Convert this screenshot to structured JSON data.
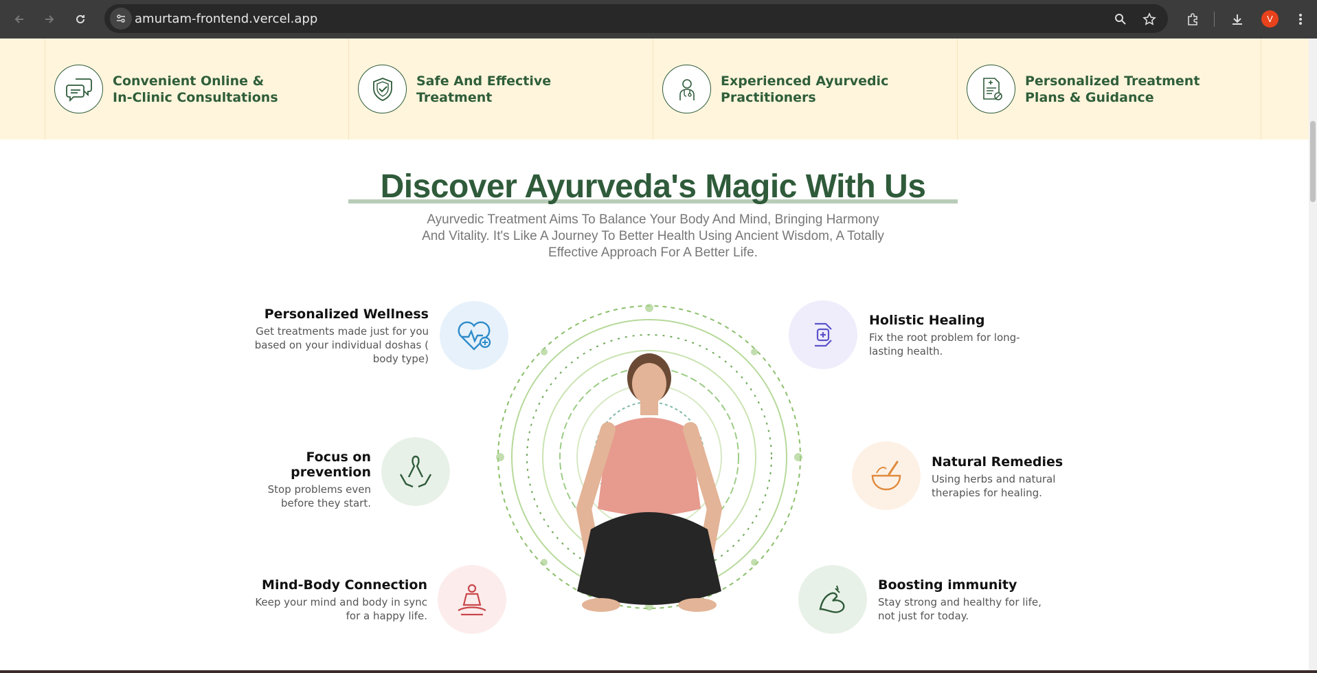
{
  "browser": {
    "url": "amurtam-frontend.vercel.app",
    "profile_initial": "V",
    "profile_color": "#e8421c"
  },
  "features": [
    {
      "line1": "Convenient Online &",
      "line2": "In-Clinic Consultations",
      "icon": "chat-bubbles-icon"
    },
    {
      "line1": "Safe And Effective",
      "line2": "Treatment",
      "icon": "shield-check-icon"
    },
    {
      "line1": "Experienced Ayurvedic",
      "line2": "Practitioners",
      "icon": "doctor-icon"
    },
    {
      "line1": "Personalized Treatment",
      "line2": "Plans & Guidance",
      "icon": "prescription-icon"
    }
  ],
  "section": {
    "title": "Discover Ayurveda's Magic With Us",
    "subtitle": "Ayurvedic Treatment Aims To Balance Your Body And Mind, Bringing Harmony And Vitality. It's Like A Journey To Better Health Using Ancient Wisdom, A Totally Effective Approach For A Better Life."
  },
  "benefits_left": [
    {
      "title": "Personalized Wellness",
      "desc": "Get treatments made just for you based on your individual doshas ( body type)",
      "icon": "heart-pulse-icon",
      "color": "#e6f1fb"
    },
    {
      "title": "Focus on prevention",
      "desc": "Stop problems even before they start.",
      "icon": "ribbon-hands-icon",
      "color": "#e8f1e8"
    },
    {
      "title": "Mind-Body Connection",
      "desc": "Keep your mind and body in sync for a happy life.",
      "icon": "meditation-icon",
      "color": "#fcecec"
    }
  ],
  "benefits_right": [
    {
      "title": "Holistic Healing",
      "desc": "Fix the root problem for long-lasting health.",
      "icon": "hands-cross-icon",
      "color": "#efedfb"
    },
    {
      "title": "Natural Remedies",
      "desc": "Using herbs and natural therapies for healing.",
      "icon": "mortar-pestle-icon",
      "color": "#fdf1e6"
    },
    {
      "title": "Boosting immunity",
      "desc": "Stay strong and healthy for life, not just for today.",
      "icon": "arm-muscle-icon",
      "color": "#e8f1e8"
    }
  ]
}
